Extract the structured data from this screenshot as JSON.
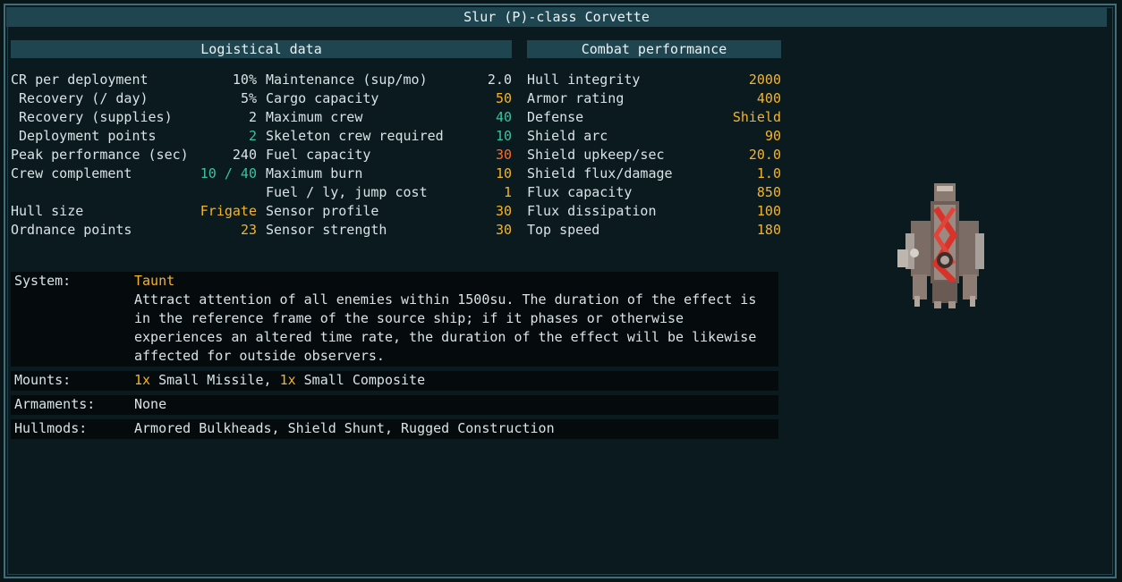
{
  "title": "Slur (P)-class Corvette",
  "logistical": {
    "header": "Logistical data",
    "col1": [
      {
        "label": "CR per deployment",
        "value": "10%",
        "color": "white"
      },
      {
        "label": " Recovery (/ day)",
        "value": "5%",
        "color": "white"
      },
      {
        "label": " Recovery (supplies)",
        "value": "2",
        "color": "white"
      },
      {
        "label": " Deployment points",
        "value": "2",
        "color": "teal"
      },
      {
        "label": "Peak performance (sec)",
        "value": "240",
        "color": "white"
      },
      {
        "label": "Crew complement",
        "value": "10 / 40",
        "color": "teal"
      },
      {
        "label": "",
        "value": "",
        "color": "white"
      },
      {
        "label": "Hull size",
        "value": "Frigate",
        "color": "orange"
      },
      {
        "label": "Ordnance points",
        "value": "23",
        "color": "orange"
      }
    ],
    "col2": [
      {
        "label": "Maintenance (sup/mo)",
        "value": "2.0",
        "color": "white"
      },
      {
        "label": "Cargo capacity",
        "value": "50",
        "color": "orange"
      },
      {
        "label": "Maximum crew",
        "value": "40",
        "color": "teal"
      },
      {
        "label": "Skeleton crew required",
        "value": "10",
        "color": "teal"
      },
      {
        "label": "Fuel capacity",
        "value": "30",
        "color": "red"
      },
      {
        "label": "Maximum burn",
        "value": "10",
        "color": "orange"
      },
      {
        "label": "Fuel / ly, jump cost",
        "value": "1",
        "color": "orange"
      },
      {
        "label": "Sensor profile",
        "value": "30",
        "color": "orange"
      },
      {
        "label": "Sensor strength",
        "value": "30",
        "color": "orange"
      }
    ]
  },
  "combat": {
    "header": "Combat performance",
    "rows": [
      {
        "label": "Hull integrity",
        "value": "2000",
        "color": "orange"
      },
      {
        "label": "Armor rating",
        "value": "400",
        "color": "orange"
      },
      {
        "label": "Defense",
        "value": "Shield",
        "color": "orange"
      },
      {
        "label": "Shield arc",
        "value": "90",
        "color": "orange"
      },
      {
        "label": "Shield upkeep/sec",
        "value": "20.0",
        "color": "orange"
      },
      {
        "label": "Shield flux/damage",
        "value": "1.0",
        "color": "orange"
      },
      {
        "label": "Flux capacity",
        "value": "850",
        "color": "orange"
      },
      {
        "label": "Flux dissipation",
        "value": "100",
        "color": "orange"
      },
      {
        "label": "Top speed",
        "value": "180",
        "color": "orange"
      }
    ]
  },
  "system": {
    "label": "System:",
    "name": "Taunt",
    "description_lines": [
      "Attract attention of all enemies within 1500su. The duration of the effect is",
      "in the reference frame of the source ship; if it phases or otherwise",
      "experiences an altered time rate, the duration of the effect will be likewise",
      "affected for outside observers."
    ]
  },
  "mounts": {
    "label": "Mounts:",
    "items": [
      {
        "count": "1x",
        "name": " Small Missile"
      },
      {
        "sep": ", "
      },
      {
        "count": "1x",
        "name": " Small Composite"
      }
    ]
  },
  "armaments": {
    "label": "Armaments:",
    "value": "None"
  },
  "hullmods": {
    "label": "Hullmods:",
    "value": "Armored Bulkheads, Shield Shunt, Rugged Construction"
  },
  "colors": {
    "white": "#d8e3e6",
    "teal": "#38c4a0",
    "orange": "#f5b428",
    "red": "#ff6a2a",
    "header_bg": "#1e4550",
    "border": "#3f6e7a"
  },
  "ship_icon": "ship-sprite"
}
